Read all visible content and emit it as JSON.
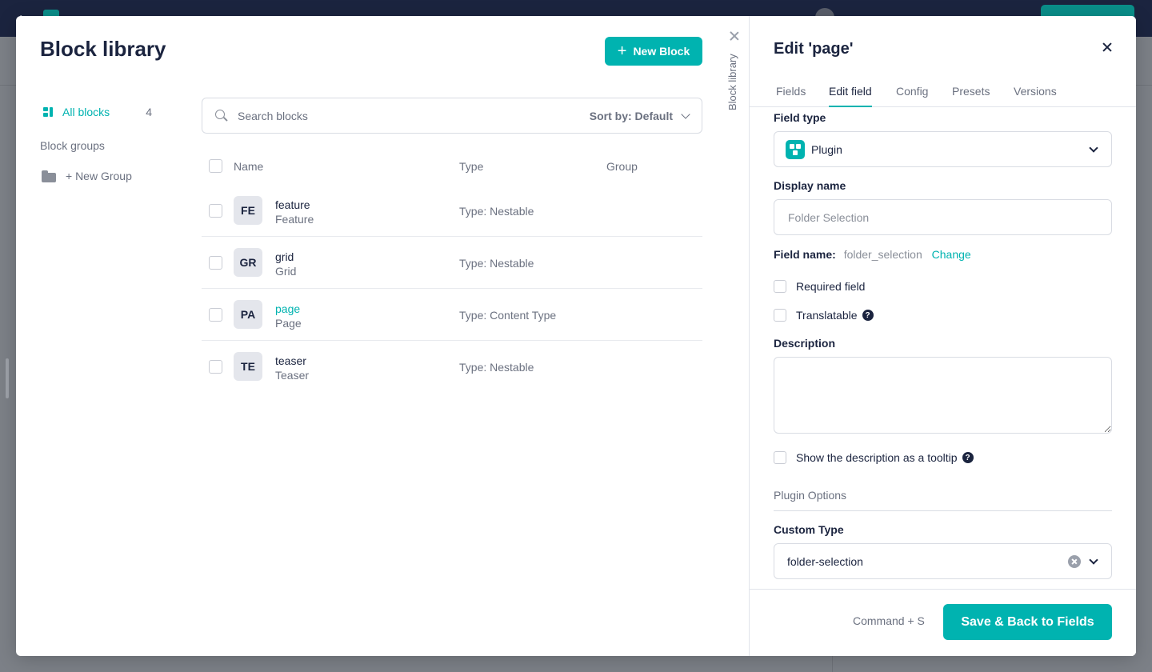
{
  "library": {
    "title": "Block library",
    "new_block_label": "New Block",
    "sidebar": {
      "all_blocks_label": "All blocks",
      "all_blocks_count": "4",
      "groups_heading": "Block groups",
      "new_group_label": "+ New Group"
    },
    "search": {
      "placeholder": "Search blocks",
      "value": ""
    },
    "sort_label": "Sort by: Default",
    "columns": [
      "Name",
      "Type",
      "Group"
    ],
    "rows": [
      {
        "initials": "FE",
        "name": "feature",
        "display": "Feature",
        "type": "Type: Nestable",
        "group": ""
      },
      {
        "initials": "GR",
        "name": "grid",
        "display": "Grid",
        "type": "Type: Nestable",
        "group": ""
      },
      {
        "initials": "PA",
        "name": "page",
        "display": "Page",
        "type": "Type: Content Type",
        "group": ""
      },
      {
        "initials": "TE",
        "name": "teaser",
        "display": "Teaser",
        "type": "Type: Nestable",
        "group": ""
      }
    ],
    "collapse_label": "Block library"
  },
  "panel": {
    "title": "Edit 'page'",
    "tabs": [
      "Fields",
      "Edit field",
      "Config",
      "Presets",
      "Versions"
    ],
    "active_tab": "Edit field",
    "field_type_label": "Field type",
    "field_type_value": "Plugin",
    "display_name_label": "Display name",
    "display_name_placeholder": "Folder Selection",
    "display_name_value": "",
    "field_name_label": "Field name:",
    "field_name_value": "folder_selection",
    "change_label": "Change",
    "required_label": "Required field",
    "translatable_label": "Translatable",
    "description_label": "Description",
    "description_value": "",
    "tooltip_label": "Show the description as a tooltip",
    "plugin_options_heading": "Plugin Options",
    "custom_type_label": "Custom Type",
    "custom_type_value": "folder-selection",
    "shortcut_label": "Command + S",
    "save_label": "Save & Back to Fields",
    "help_glyph": "?"
  },
  "colors": {
    "accent": "#00b3b0",
    "text_primary": "#1b243f",
    "text_secondary": "#6b7180"
  }
}
